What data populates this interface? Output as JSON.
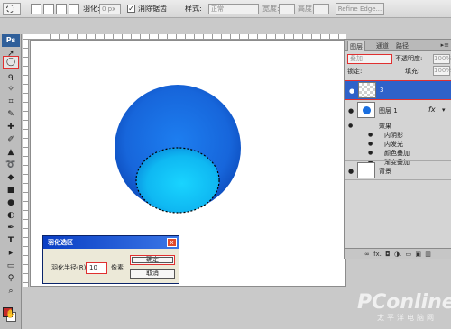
{
  "options_bar": {
    "feather_label": "羽化:",
    "feather_value": "0 px",
    "anti_alias_label": "消除锯齿",
    "anti_alias_checked": true,
    "style_label": "样式:",
    "style_value": "正常",
    "width_label": "宽度:",
    "height_label": "高度:",
    "refine_edge": "Refine Edge..."
  },
  "toolbox": {
    "logo": "Ps",
    "active_tool_icon": "elliptical-marquee-icon",
    "foreground_color": "#c42a2a",
    "background_color": "#ffffff"
  },
  "canvas": {
    "background": "#ffffff",
    "ball_color": "#1a73e8",
    "highlight_color": "#12c9f5"
  },
  "layers_panel": {
    "tabs": [
      "图层",
      "通道",
      "路径"
    ],
    "active_tab": "图层",
    "blend_mode": "叠加",
    "opacity_label": "不透明度:",
    "opacity_value": "100%",
    "lock_label": "锁定:",
    "fill_label": "填充:",
    "fill_value": "100%",
    "layers": [
      {
        "name": "3",
        "selected": true
      },
      {
        "name": "图层 1",
        "selected": false
      },
      {
        "name": "背景",
        "selected": false
      }
    ],
    "effects_header": "效果",
    "effects": [
      "内阴影",
      "内发光",
      "颜色叠加",
      "渐变叠加"
    ],
    "fx_label": "fx"
  },
  "feather_dialog": {
    "title": "羽化选区",
    "close_label": "x",
    "radius_label": "羽化半径(R):",
    "radius_value": "10",
    "unit": "像素",
    "ok_label": "确定",
    "cancel_label": "取消"
  },
  "watermark": {
    "brand": "PConline",
    "sub": "太平洋电脑网"
  }
}
